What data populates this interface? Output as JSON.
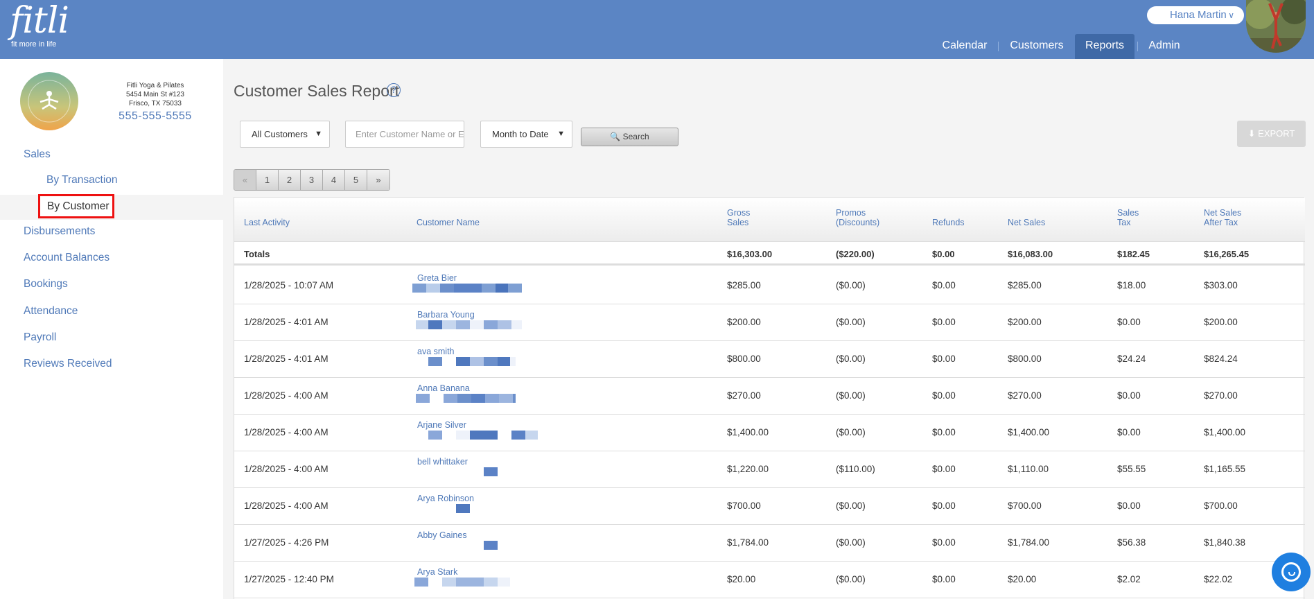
{
  "app": {
    "logo_text": "fitli",
    "logo_tagline": "fit more in life"
  },
  "user": {
    "name": "Hana Martin"
  },
  "nav": {
    "items": [
      {
        "label": "Calendar"
      },
      {
        "label": "Customers"
      },
      {
        "label": "Reports"
      },
      {
        "label": "Admin"
      }
    ],
    "active": "Reports"
  },
  "studio": {
    "name": "Fitli Yoga & Pilates",
    "address1": "5454 Main St #123",
    "address2": "Frisco, TX 75033",
    "phone": "555-555-5555",
    "logo_text": "FITLI YOGA & PILATES"
  },
  "sidebar": {
    "sales": "Sales",
    "by_transaction": "By Transaction",
    "by_customer": "By Customer",
    "disbursements": "Disbursements",
    "account_balances": "Account Balances",
    "bookings": "Bookings",
    "attendance": "Attendance",
    "payroll": "Payroll",
    "reviews": "Reviews Received"
  },
  "report": {
    "title": "Customer Sales Report",
    "help_icon": "?",
    "filter_customers": "All Customers",
    "search_placeholder": "Enter Customer Name or E",
    "filter_range": "Month to Date",
    "search_label": "Search",
    "export_label": "EXPORT"
  },
  "pagination": {
    "prev": "«",
    "pages": [
      "1",
      "2",
      "3",
      "4",
      "5"
    ],
    "next": "»"
  },
  "table": {
    "headers": {
      "last_activity": "Last Activity",
      "customer_name": "Customer Name",
      "gross_1": "Gross",
      "gross_2": "Sales",
      "promos_1": "Promos",
      "promos_2": "(Discounts)",
      "refunds": "Refunds",
      "net_sales": "Net Sales",
      "tax_1": "Sales",
      "tax_2": "Tax",
      "after_1": "Net Sales",
      "after_2": "After Tax"
    },
    "totals": {
      "label": "Totals",
      "gross": "$16,303.00",
      "promos": "($220.00)",
      "refunds": "$0.00",
      "net": "$16,083.00",
      "tax": "$182.45",
      "after": "$16,265.45"
    },
    "rows": [
      {
        "date": "1/28/2025 - 10:07 AM",
        "name": "Greta Bier",
        "gross": "$285.00",
        "promos": "($0.00)",
        "refunds": "$0.00",
        "net": "$285.00",
        "tax": "$18.00",
        "after": "$303.00"
      },
      {
        "date": "1/28/2025 - 4:01 AM",
        "name": "Barbara Young",
        "gross": "$200.00",
        "promos": "($0.00)",
        "refunds": "$0.00",
        "net": "$200.00",
        "tax": "$0.00",
        "after": "$200.00"
      },
      {
        "date": "1/28/2025 - 4:01 AM",
        "name": "ava smith",
        "gross": "$800.00",
        "promos": "($0.00)",
        "refunds": "$0.00",
        "net": "$800.00",
        "tax": "$24.24",
        "after": "$824.24"
      },
      {
        "date": "1/28/2025 - 4:00 AM",
        "name": "Anna Banana",
        "gross": "$270.00",
        "promos": "($0.00)",
        "refunds": "$0.00",
        "net": "$270.00",
        "tax": "$0.00",
        "after": "$270.00"
      },
      {
        "date": "1/28/2025 - 4:00 AM",
        "name": "Arjane Silver",
        "gross": "$1,400.00",
        "promos": "($0.00)",
        "refunds": "$0.00",
        "net": "$1,400.00",
        "tax": "$0.00",
        "after": "$1,400.00"
      },
      {
        "date": "1/28/2025 - 4:00 AM",
        "name": "bell whittaker",
        "gross": "$1,220.00",
        "promos": "($110.00)",
        "refunds": "$0.00",
        "net": "$1,110.00",
        "tax": "$55.55",
        "after": "$1,165.55"
      },
      {
        "date": "1/28/2025 - 4:00 AM",
        "name": "Arya Robinson",
        "gross": "$700.00",
        "promos": "($0.00)",
        "refunds": "$0.00",
        "net": "$700.00",
        "tax": "$0.00",
        "after": "$700.00"
      },
      {
        "date": "1/27/2025 - 4:26 PM",
        "name": "Abby Gaines",
        "gross": "$1,784.00",
        "promos": "($0.00)",
        "refunds": "$0.00",
        "net": "$1,784.00",
        "tax": "$56.38",
        "after": "$1,840.38"
      },
      {
        "date": "1/27/2025 - 12:40 PM",
        "name": "Arya Stark",
        "gross": "$20.00",
        "promos": "($0.00)",
        "refunds": "$0.00",
        "net": "$20.00",
        "tax": "$2.02",
        "after": "$22.02"
      }
    ]
  },
  "colors": {
    "header_blue": "#5b85c4",
    "link_blue": "#4f79b8",
    "highlight_red": "#e11111",
    "chat_blue": "#1f7fe0"
  }
}
